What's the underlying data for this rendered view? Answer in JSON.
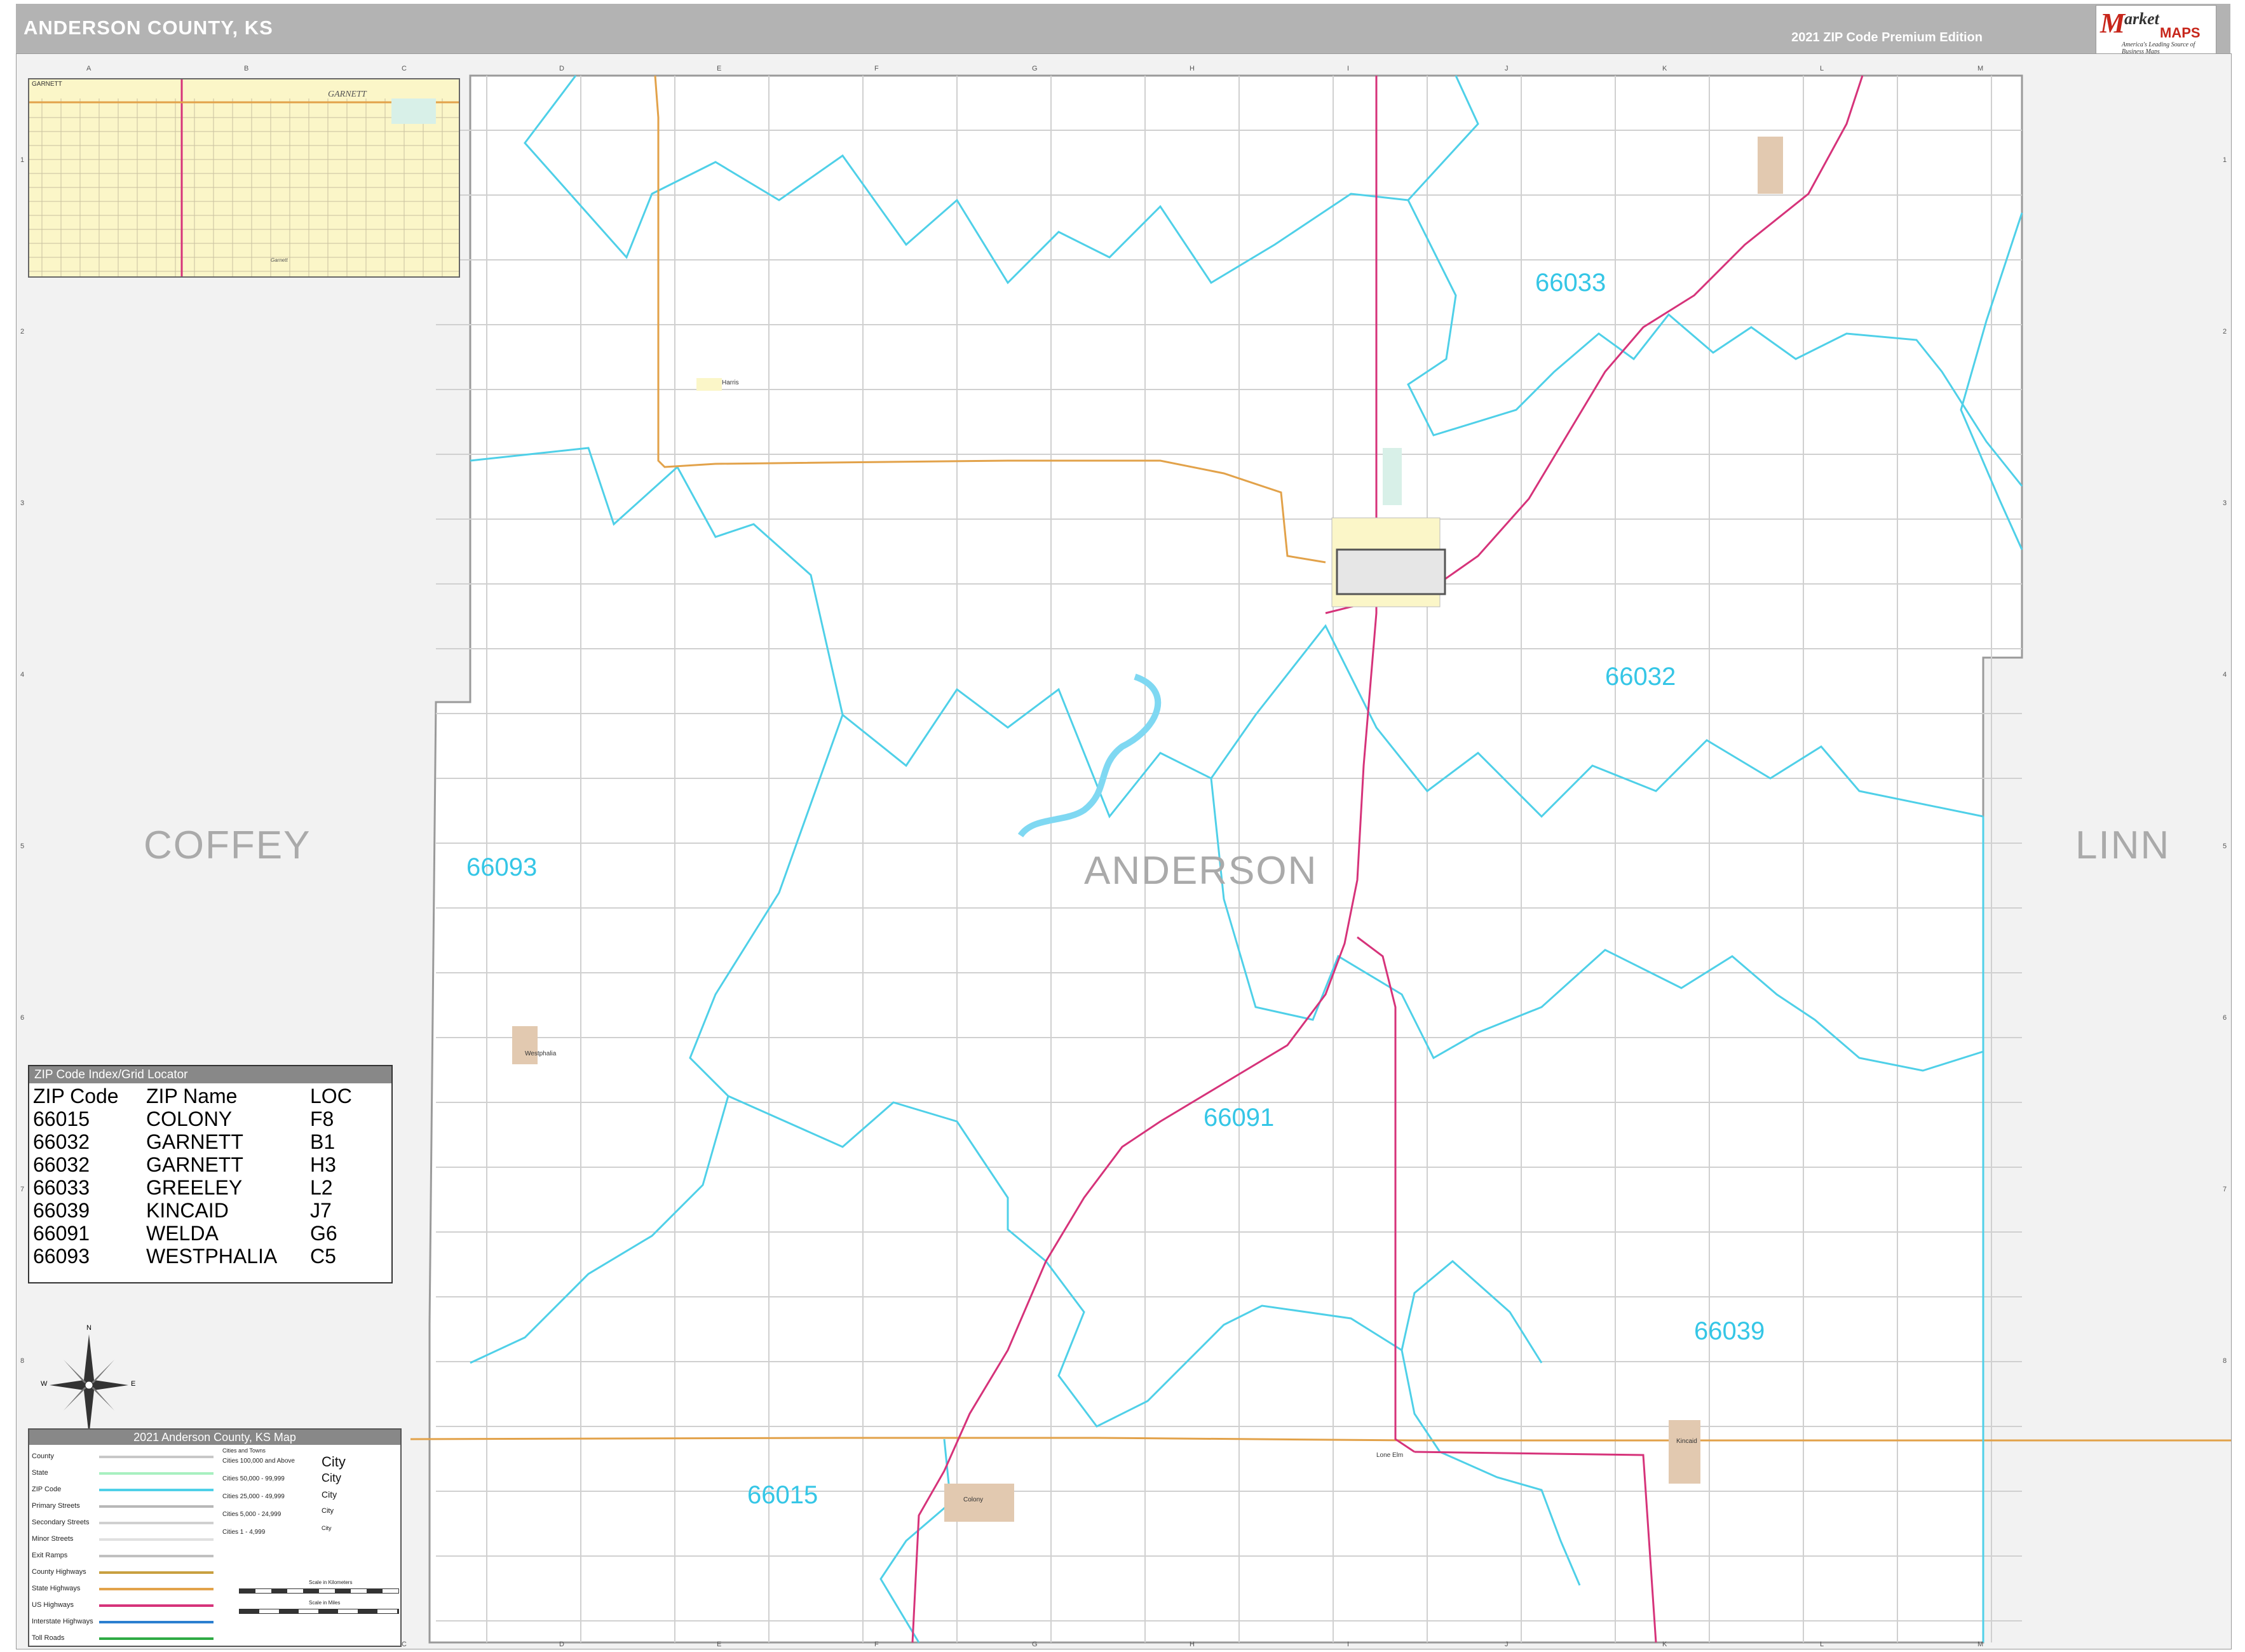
{
  "header": {
    "title": "ANDERSON COUNTY, KS",
    "edition": "2021 ZIP Code Premium Edition"
  },
  "logo": {
    "brand_letter": "M",
    "brand_top": "arket",
    "brand_bottom": "MAPS",
    "slogan": "America's Leading Source of Business Maps"
  },
  "grid": {
    "columns": [
      "A",
      "B",
      "C",
      "D",
      "E",
      "F",
      "G",
      "H",
      "I",
      "J",
      "K",
      "L",
      "M"
    ],
    "rows": [
      "1",
      "2",
      "3",
      "4",
      "5",
      "6",
      "7",
      "8"
    ]
  },
  "counties": {
    "main": "ANDERSON",
    "west": "COFFEY",
    "east": "LINN"
  },
  "zip_labels": [
    "66033",
    "66032",
    "66093",
    "66091",
    "66039",
    "66015"
  ],
  "inset": {
    "label": "GARNETT",
    "city": "GARNETT",
    "street_label": "Garnett"
  },
  "zip_index": {
    "title": "ZIP Code Index/Grid Locator",
    "headers": [
      "ZIP Code",
      "ZIP Name",
      "LOC"
    ],
    "rows": [
      [
        "66015",
        "COLONY",
        "F8"
      ],
      [
        "66032",
        "GARNETT",
        "B1"
      ],
      [
        "66032",
        "GARNETT",
        "H3"
      ],
      [
        "66033",
        "GREELEY",
        "L2"
      ],
      [
        "66039",
        "KINCAID",
        "J7"
      ],
      [
        "66091",
        "WELDA",
        "G6"
      ],
      [
        "66093",
        "WESTPHALIA",
        "C5"
      ]
    ]
  },
  "legend": {
    "title": "2021 Anderson County, KS Map",
    "items": [
      "County",
      "State",
      "ZIP Code",
      "Primary Streets",
      "Secondary Streets",
      "Minor Streets",
      "Exit Ramps",
      "County Highways",
      "State Highways",
      "US Highways",
      "Interstate Highways",
      "Toll Roads"
    ],
    "cities_title": "Cities and Towns",
    "city_sizes": [
      "Cities 100,000 and Above",
      "Cities 50,000 - 99,999",
      "Cities 25,000 - 49,999",
      "Cities 5,000 - 24,999",
      "Cities 1 - 4,999"
    ],
    "city_samples": [
      "City",
      "City",
      "City",
      "City",
      "City"
    ],
    "scale_km": "Scale in Kilometers",
    "scale_mi": "Scale in Miles"
  },
  "compass": {
    "n": "N",
    "s": "S",
    "e": "E",
    "w": "W"
  },
  "towns": {
    "westphalia": "Westphalia",
    "colony": "Colony",
    "kincaid": "Kincaid",
    "lone_elm": "Lone Elm",
    "harris": "Harris"
  },
  "colors": {
    "header_bg": "#b3b3b3",
    "zip_boundary": "#4fd0e8",
    "us_highway": "#d6337a",
    "state_highway": "#e2a24a",
    "county_fill_outside": "#f2f2f2",
    "town_fill": "#e2c9b0",
    "inset_fill": "#fbf6c8",
    "water": "#7fd8f2"
  }
}
